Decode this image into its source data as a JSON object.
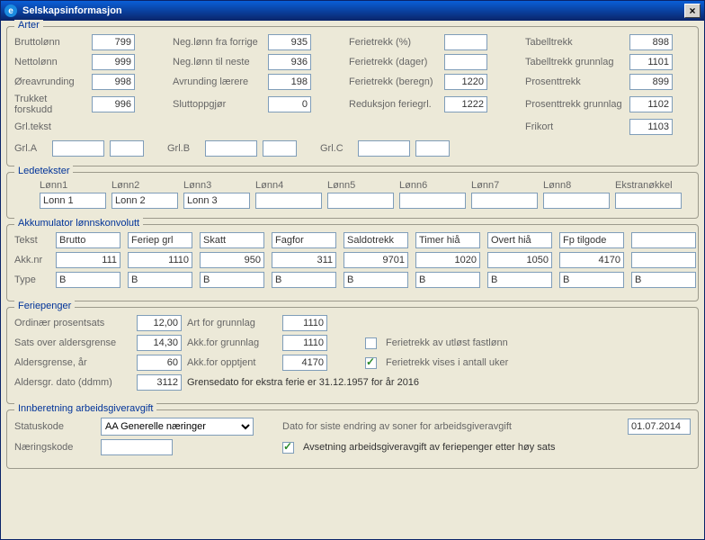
{
  "window": {
    "title": "Selskapsinformasjon"
  },
  "groups": {
    "arter": "Arter",
    "ledetekster": "Ledetekster",
    "akk": "Akkumulator lønnskonvolutt",
    "fp": "Feriepenger",
    "inn": "Innberetning arbeidsgiveravgift"
  },
  "arter": {
    "bruttolonn_lbl": "Bruttolønn",
    "bruttolonn": "799",
    "nettolonn_lbl": "Nettolønn",
    "nettolonn": "999",
    "oreavrunding_lbl": "Øreavrunding",
    "oreavrunding": "998",
    "trukket_lbl": "Trukket forskudd",
    "trukket": "996",
    "grltekst_lbl": "Grl.tekst",
    "neg_forrige_lbl": "Neg.lønn fra forrige",
    "neg_forrige": "935",
    "neg_neste_lbl": "Neg.lønn til neste",
    "neg_neste": "936",
    "avrund_lbl": "Avrunding lærere",
    "avrund": "198",
    "sluttopp_lbl": "Sluttoppgjør",
    "sluttopp": "0",
    "ft_pst_lbl": "Ferietrekk (%)",
    "ft_pst": "",
    "ft_dager_lbl": "Ferietrekk (dager)",
    "ft_dager": "",
    "ft_beregn_lbl": "Ferietrekk (beregn)",
    "ft_beregn": "1220",
    "red_lbl": "Reduksjon feriegrl.",
    "red": "1222",
    "tabelltrekk_lbl": "Tabelltrekk",
    "tabelltrekk": "898",
    "tabelltrekk_gr_lbl": "Tabelltrekk grunnlag",
    "tabelltrekk_gr": "1101",
    "prosenttrekk_lbl": "Prosenttrekk",
    "prosenttrekk": "899",
    "prosenttrekk_gr_lbl": "Prosenttrekk grunnlag",
    "prosenttrekk_gr": "1102",
    "frikort_lbl": "Frikort",
    "frikort": "1103",
    "grla_lbl": "Grl.A",
    "grlb_lbl": "Grl.B",
    "grlc_lbl": "Grl.C"
  },
  "lede": {
    "hdr": [
      "Lønn1",
      "Lønn2",
      "Lønn3",
      "Lønn4",
      "Lønn5",
      "Lønn6",
      "Lønn7",
      "Lønn8",
      "Ekstranøkkel"
    ],
    "vals": [
      "Lonn 1",
      "Lonn 2",
      "Lonn 3",
      "",
      "",
      "",
      "",
      "",
      ""
    ]
  },
  "akk": {
    "tekst_lbl": "Tekst",
    "akknr_lbl": "Akk.nr",
    "type_lbl": "Type",
    "tekst": [
      "Brutto",
      "Feriep grl",
      "Skatt",
      "Fagfor",
      "Saldotrekk",
      "Timer hiå",
      "Overt hiå",
      "Fp tilgode",
      ""
    ],
    "nr": [
      "111",
      "1110",
      "950",
      "311",
      "9701",
      "1020",
      "1050",
      "4170",
      ""
    ],
    "type": [
      "B",
      "B",
      "B",
      "B",
      "B",
      "B",
      "B",
      "B",
      "B"
    ]
  },
  "fp": {
    "ord_lbl": "Ordinær prosentsats",
    "ord": "12,00",
    "sats_lbl": "Sats over aldersgrense",
    "sats": "14,30",
    "alder_lbl": "Aldersgrense, år",
    "alder": "60",
    "dato_lbl": "Aldersgr. dato (ddmm)",
    "dato": "3112",
    "art_lbl": "Art for grunnlag",
    "art": "1110",
    "akkgr_lbl": "Akk.for grunnlag",
    "akkgr": "1110",
    "akkop_lbl": "Akk.for opptjent",
    "akkop": "4170",
    "chk1": "Ferietrekk av utløst fastlønn",
    "chk2": "Ferietrekk vises i antall uker",
    "grense": "Grensedato for ekstra ferie er 31.12.1957 for år 2016"
  },
  "inn": {
    "status_lbl": "Statuskode",
    "status": "AA Generelle næringer",
    "naering_lbl": "Næringskode",
    "naering": "",
    "dato_lbl": "Dato for siste endring av soner for arbeidsgiveravgift",
    "dato": "01.07.2014",
    "chk": "Avsetning arbeidsgiveravgift av feriepenger etter høy sats"
  }
}
